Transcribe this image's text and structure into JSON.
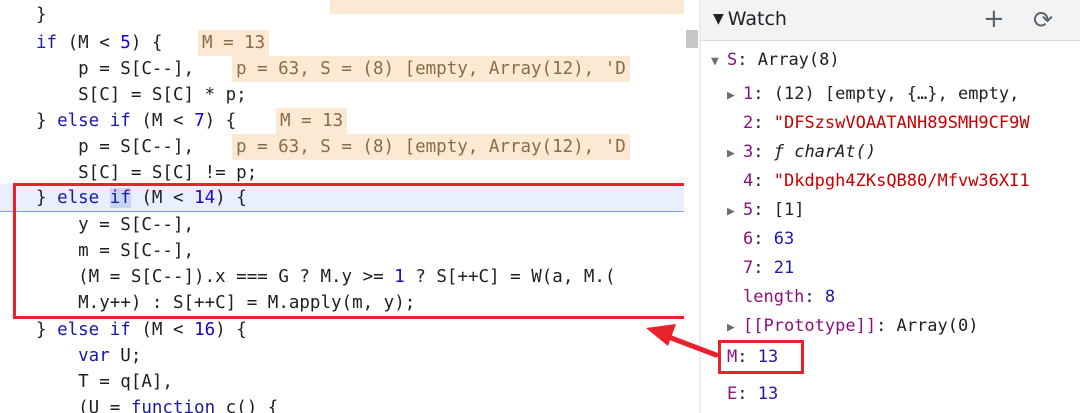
{
  "editor": {
    "line0": "}",
    "line1_kw": "if",
    "line1_a": " (M < ",
    "line1_num": "5",
    "line1_b": ") {",
    "line1_hl": "M = 13",
    "line2": "    p = S[C--],",
    "line2_hl": "p = 63, S = (8) [empty, Array(12), 'D",
    "line3": "    S[C] = S[C] * p;",
    "line4_a": "} ",
    "line4_kw": "else if",
    "line4_b": " (M < ",
    "line4_num": "7",
    "line4_c": ") {",
    "line4_hl": "M = 13",
    "line5": "    p = S[C--],",
    "line5_hl": "p = 63, S = (8) [empty, Array(12), 'D",
    "line6": "    S[C] = S[C] != p;",
    "line7_a": "} ",
    "line7_kw1": "else",
    "line7_sel": "if",
    "line7_b": " (M < ",
    "line7_num": "14",
    "line7_c": ") {",
    "line8": "    y = S[C--],",
    "line9": "    m = S[C--],",
    "line10_a": "    (M = S[C--]).x === G ? M.y >= ",
    "line10_num": "1",
    "line10_b": " ? S[++C] = W(a, M.(",
    "line11": "    M.y++) : S[++C] = M.apply(m, y);",
    "line12_a": "} ",
    "line12_kw": "else if",
    "line12_b": " (M < ",
    "line12_num": "16",
    "line12_c": ") {",
    "line13_kw": "    var",
    "line13_b": " U;",
    "line14": "    T = q[A],",
    "line15_a": "    (U = ",
    "line15_kw": "function",
    "line15_b": " c() {"
  },
  "watch": {
    "title": "Watch",
    "add_icon": "+",
    "refresh_icon": "⟳",
    "items": [
      {
        "key": "S",
        "sep": ": ",
        "val": "Array(8)"
      },
      {
        "key": "1",
        "sep": ": ",
        "val": "(12) [empty, {…}, empty,"
      },
      {
        "key": "2",
        "sep": ": ",
        "val": "\"DFSzswVOAATANH89SMH9CF9W"
      },
      {
        "key": "3",
        "sep": ": ",
        "val": "ƒ charAt()"
      },
      {
        "key": "4",
        "sep": ": ",
        "val": "\"Dkdpgh4ZKsQB80/Mfvw36XI1"
      },
      {
        "key": "5",
        "sep": ": ",
        "val": "[1]"
      },
      {
        "key": "6",
        "sep": ": ",
        "val": "63"
      },
      {
        "key": "7",
        "sep": ": ",
        "val": "21"
      },
      {
        "key": "length",
        "sep": ": ",
        "val": "8"
      },
      {
        "key": "[[Prototype]]",
        "sep": ": ",
        "val": "Array(0)"
      },
      {
        "key": "M",
        "sep": ": ",
        "val": "13"
      },
      {
        "key": "E",
        "sep": ": ",
        "val": "13"
      }
    ]
  },
  "colors": {
    "highlight_box": "#e8212b",
    "current_line": "#e8efff"
  }
}
